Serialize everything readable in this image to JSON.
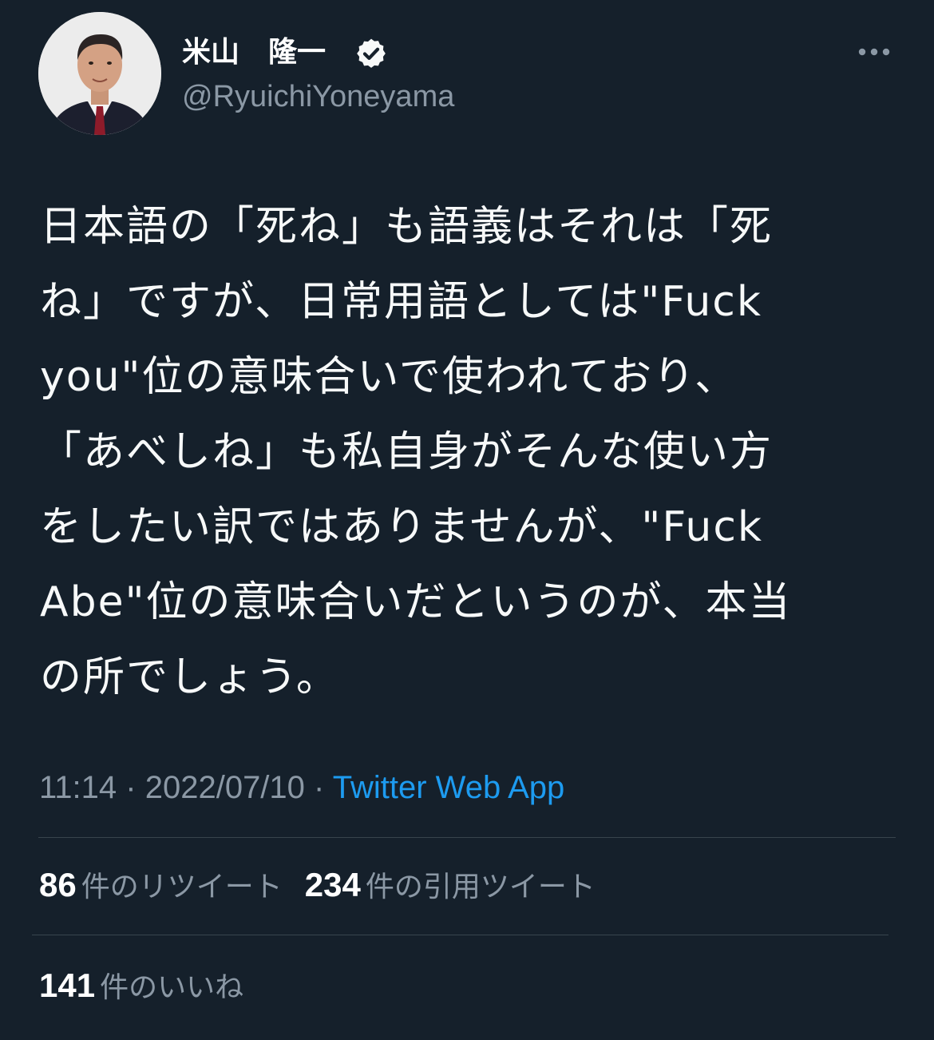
{
  "author": {
    "name": "米山　隆一",
    "handle": "@RyuichiYoneyama",
    "verified": true
  },
  "tweet": {
    "lines": [
      "日本語の「死ね」も語義はそれは「死",
      "ね」ですが、日常用語としては\"Fuck",
      "you\"位の意味合いで使われており、",
      "「あべしね」も私自身がそんな使い方",
      "をしたい訳ではありませんが、\"Fuck",
      "Abe\"位の意味合いだというのが、本当",
      "の所でしょう。"
    ]
  },
  "meta": {
    "time": "11:14",
    "date": "2022/07/10",
    "separator": "·",
    "source": "Twitter Web App"
  },
  "stats": {
    "retweets": {
      "count": "86",
      "label": "件のリツイート"
    },
    "quotes": {
      "count": "234",
      "label": "件の引用ツイート"
    },
    "likes": {
      "count": "141",
      "label": "件のいいね"
    }
  },
  "icons": {
    "verified_badge": "verified-badge-icon",
    "more": "more-options-icon"
  },
  "colors": {
    "background": "#15202b",
    "text_primary": "#f7f9f9",
    "text_secondary": "#8b98a5",
    "link": "#1d9bf0",
    "divider": "#38444d"
  }
}
